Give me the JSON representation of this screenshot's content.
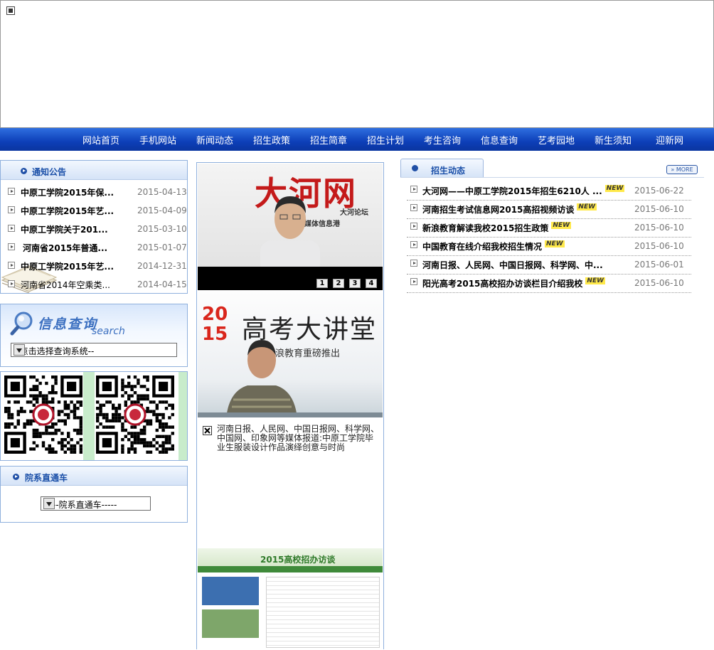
{
  "nav": [
    "网站首页",
    "手机网站",
    "新闻动态",
    "招生政策",
    "招生简章",
    "招生计划",
    "考生咨询",
    "信息查询",
    "艺考园地",
    "新生须知",
    "迎新网"
  ],
  "notice": {
    "title": "通知公告",
    "items": [
      {
        "title": "中原工学院2015年保...",
        "date": "2015-04-13"
      },
      {
        "title": "中原工学院2015年艺...",
        "date": "2015-04-09"
      },
      {
        "title": "中原工学院关于201...",
        "date": "2015-03-10"
      },
      {
        "title": "河南省2015年普通...",
        "date": "2015-01-07"
      },
      {
        "title": "中原工学院2015年艺...",
        "date": "2014-12-31"
      },
      {
        "title": "河南省2014年空乘类...",
        "date": "2014-04-15"
      }
    ]
  },
  "info_query": {
    "title": "信息查询",
    "subtitle": "search",
    "select_value": "--点击选择查询系统--"
  },
  "dept": {
    "title": "院系直通车",
    "select_value": "-----院系直通车-----"
  },
  "slideshow": {
    "logo_text": "大河网",
    "sub_text_1": "大河论坛",
    "sub_text_2": "媒体信息港",
    "pages": [
      "1",
      "2",
      "3",
      "4"
    ]
  },
  "lecture": {
    "title": "高考大讲堂",
    "year": "2015",
    "subtitle": "新浪教育重磅推出"
  },
  "caption": "河南日报、人民网、中国日报网、科学网、中国网、印象网等媒体报道:中原工学院毕业生服装设计作品演绎创意与时尚",
  "interview": {
    "title": "2015高校招办访谈"
  },
  "admissions": {
    "title": "招生动态",
    "more": "MORE",
    "items": [
      {
        "title": "大河网——中原工学院2015年招生6210人 ...",
        "date": "2015-06-22",
        "new": true
      },
      {
        "title": "河南招生考试信息网2015高招视频访谈",
        "date": "2015-06-10",
        "new": true
      },
      {
        "title": "新浪教育解读我校2015招生政策",
        "date": "2015-06-10",
        "new": true
      },
      {
        "title": "中国教育在线介绍我校招生情况",
        "date": "2015-06-10",
        "new": true
      },
      {
        "title": "河南日报、人民网、中国日报网、科学网、中...",
        "date": "2015-06-01",
        "new": false
      },
      {
        "title": "阳光高考2015高校招办访谈栏目介绍我校",
        "date": "2015-06-10",
        "new": true
      }
    ],
    "new_label": "NEW"
  },
  "colors": {
    "nav_bg": "#0d3fb8",
    "accent": "#1a4fa8",
    "date": "#777777",
    "new_badge": "#ffe94a"
  }
}
